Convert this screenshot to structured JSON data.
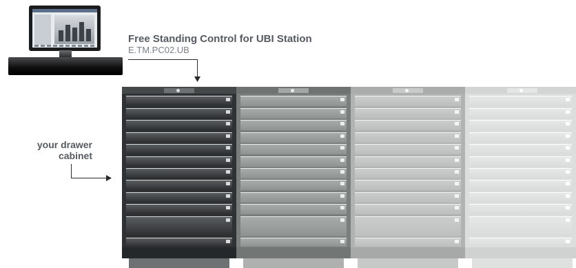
{
  "header": {
    "product_title": "Free Standing Control for UBI Station",
    "product_code": "E.TM.PC02.UB"
  },
  "callout": {
    "label_line1": "your drawer",
    "label_line2": "cabinet"
  },
  "colors": {
    "cabinet_1": "#2f3235",
    "cabinet_2": "#7a7f7d",
    "cabinet_3": "#b0b3b1",
    "cabinet_4": "#dcdede",
    "text_dark": "#555a60",
    "text_light": "#7b8086"
  },
  "icons": {
    "computer": "desktop-computer-icon",
    "arrow": "arrow-down-icon"
  }
}
